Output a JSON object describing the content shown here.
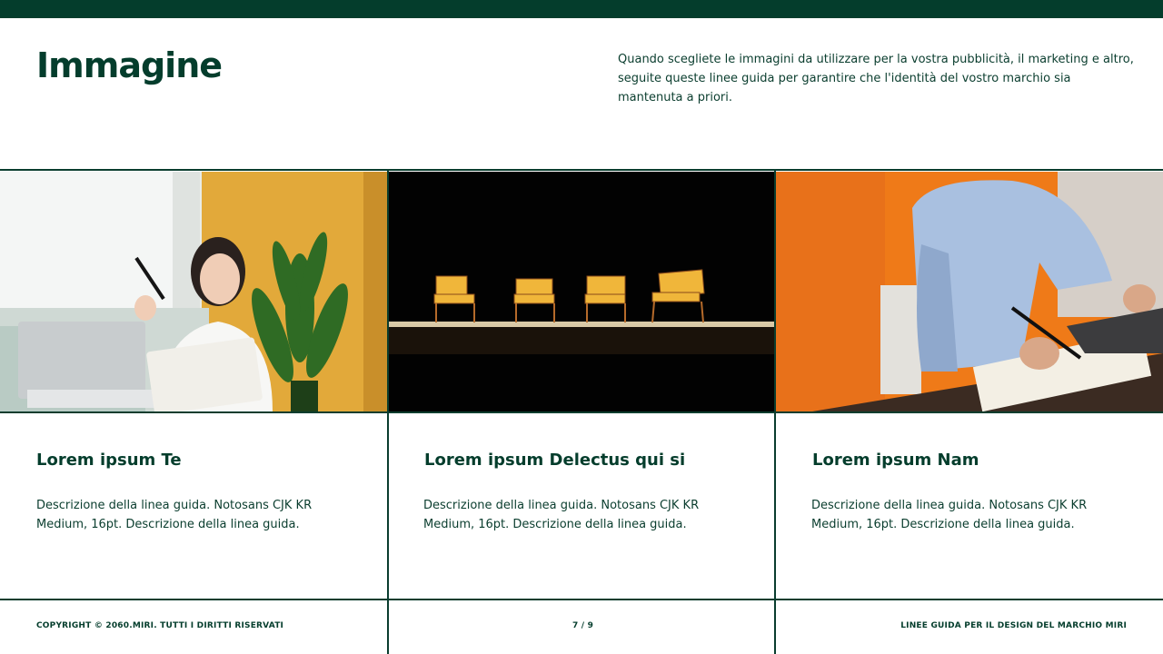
{
  "page": {
    "title": "Immagine",
    "intro": "Quando scegliete le immagini da utilizzare per la vostra pubblicità, il marketing e altro, seguite queste linee guida per garantire che l'identità del vostro marchio sia mantenuta a priori."
  },
  "cards": [
    {
      "title": "Lorem ipsum Te",
      "description": "Descrizione della linea guida. Notosans CJK KR Medium, 16pt. Descrizione della linea guida."
    },
    {
      "title": "Lorem ipsum Delectus qui si",
      "description": "Descrizione della linea guida. Notosans CJK KR Medium, 16pt. Descrizione della linea guida."
    },
    {
      "title": "Lorem ipsum Nam",
      "description": "Descrizione della linea guida. Notosans CJK KR Medium, 16pt. Descrizione della linea guida."
    }
  ],
  "footer": {
    "copyright": "COPYRIGHT © 2060.MIRI. TUTTI I DIRITTI RISERVATI",
    "page_number": "7 / 9",
    "guide_title": "LINEE GUIDA PER IL DESIGN DEL MARCHIO MIRI"
  },
  "colors": {
    "brand_green": "#043d2c",
    "background": "#ffffff"
  }
}
